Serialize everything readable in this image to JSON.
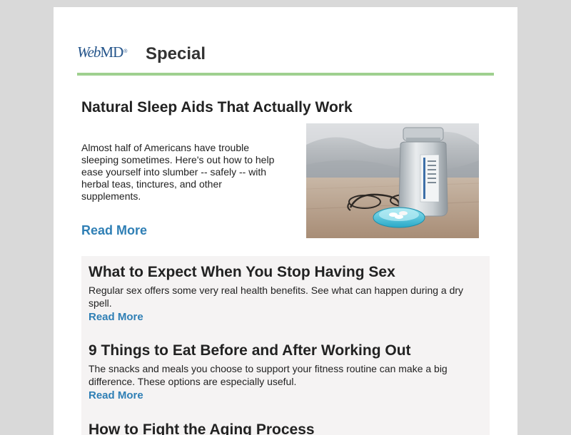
{
  "header": {
    "logo_web": "Web",
    "logo_md": "MD",
    "logo_tm": "®",
    "title": "Special"
  },
  "feature": {
    "title": "Natural Sleep Aids That Actually Work",
    "description": "Almost half of Americans have trouble sleeping sometimes. Here's out how to help ease yourself into slumber -- safely -- with herbal teas, tinctures, and other supplements.",
    "read_more": "Read More",
    "image_icon": "pill-bottle-and-glasses-photo"
  },
  "stories": [
    {
      "title": "What to Expect When You Stop Having Sex",
      "description": "Regular sex offers some very real health benefits. See what can happen during a dry spell.",
      "read_more": "Read More"
    },
    {
      "title": "9 Things to Eat Before and After Working Out",
      "description": "The snacks and meals you choose to support your fitness routine can make a big difference. These options are especially useful.",
      "read_more": "Read More"
    },
    {
      "title": "How to Fight the Aging Process",
      "description": "",
      "read_more": ""
    }
  ],
  "colors": {
    "brand_blue": "#25558b",
    "link_blue": "#2f7fb5",
    "accent_green": "#9fd08f",
    "list_bg": "#f5f3f3",
    "page_bg": "#d9d9d9"
  }
}
